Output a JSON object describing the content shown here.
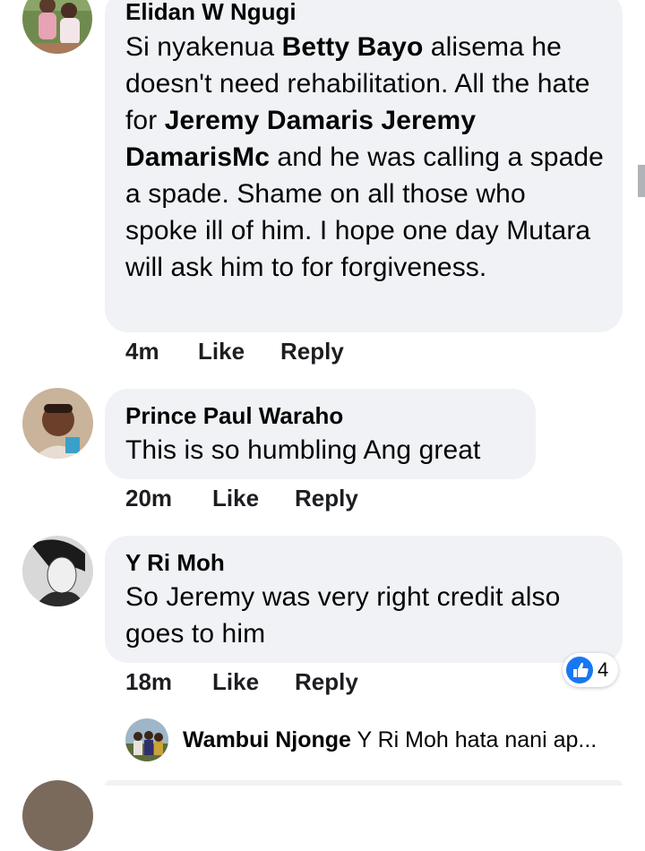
{
  "comments": [
    {
      "author": "Elidan W Ngugi",
      "text_parts": {
        "p1": "Si nyakenua ",
        "m1": "Betty Bayo",
        "p2": " alisema he doesn't need rehabilitation. All the hate for ",
        "m2": "Jeremy Damaris Jeremy DamarisMc",
        "p3": " and he was calling a spade a spade. Shame on all those who spoke ill of him. I hope one day Mutara will ask him to for forgiveness."
      },
      "time": "4m",
      "like_label": "Like",
      "reply_label": "Reply"
    },
    {
      "author": "Prince Paul Waraho",
      "text": "This is so humbling Ang great",
      "time": "20m",
      "like_label": "Like",
      "reply_label": "Reply"
    },
    {
      "author": "Y Ri Moh",
      "text": "So Jeremy was very right credit also goes to him",
      "time": "18m",
      "like_label": "Like",
      "reply_label": "Reply",
      "reaction": {
        "icon": "thumbs-up-icon",
        "count": "4",
        "color": "#1877f2"
      }
    }
  ],
  "reply_preview": {
    "author": "Wambui Njonge",
    "text": "Y Ri Moh hata nani ap..."
  },
  "colors": {
    "bubble": "#f0f2f5",
    "text": "#050505",
    "like_blue": "#1877f2"
  }
}
